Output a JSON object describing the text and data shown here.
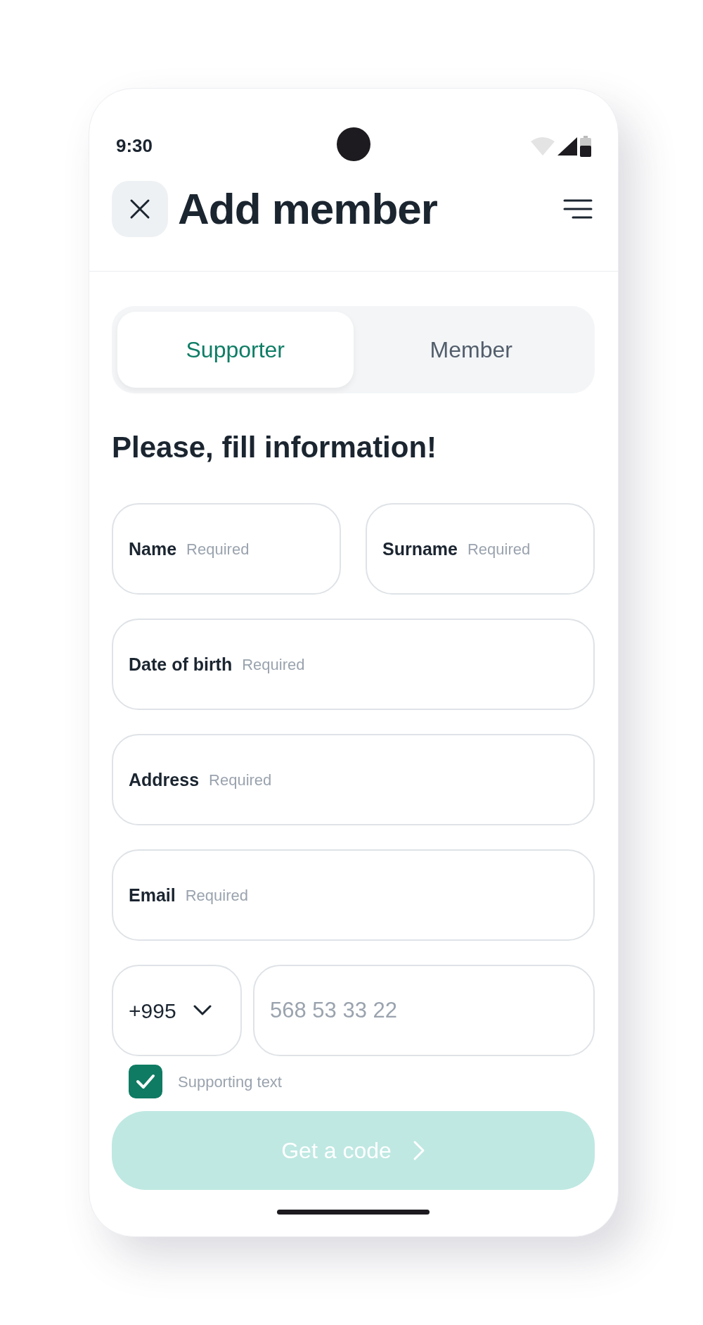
{
  "status_bar": {
    "time": "9:30"
  },
  "header": {
    "title": "Add member"
  },
  "tabs": [
    {
      "label": "Supporter",
      "selected": true
    },
    {
      "label": "Member",
      "selected": false
    }
  ],
  "heading": "Please, fill information!",
  "fields": [
    {
      "label": "Name",
      "placeholder": "Required"
    },
    {
      "label": "Surname",
      "placeholder": "Required"
    },
    {
      "label": "Date of birth",
      "placeholder": "Required"
    },
    {
      "label": "Address",
      "placeholder": "Required"
    },
    {
      "label": "Email",
      "placeholder": "Required"
    }
  ],
  "phone": {
    "country_code": "+995",
    "placeholder": "568 53 33 22"
  },
  "consent": {
    "label": "Supporting text",
    "checked": true
  },
  "submit": {
    "label": "Get a code",
    "disabled": true
  }
}
